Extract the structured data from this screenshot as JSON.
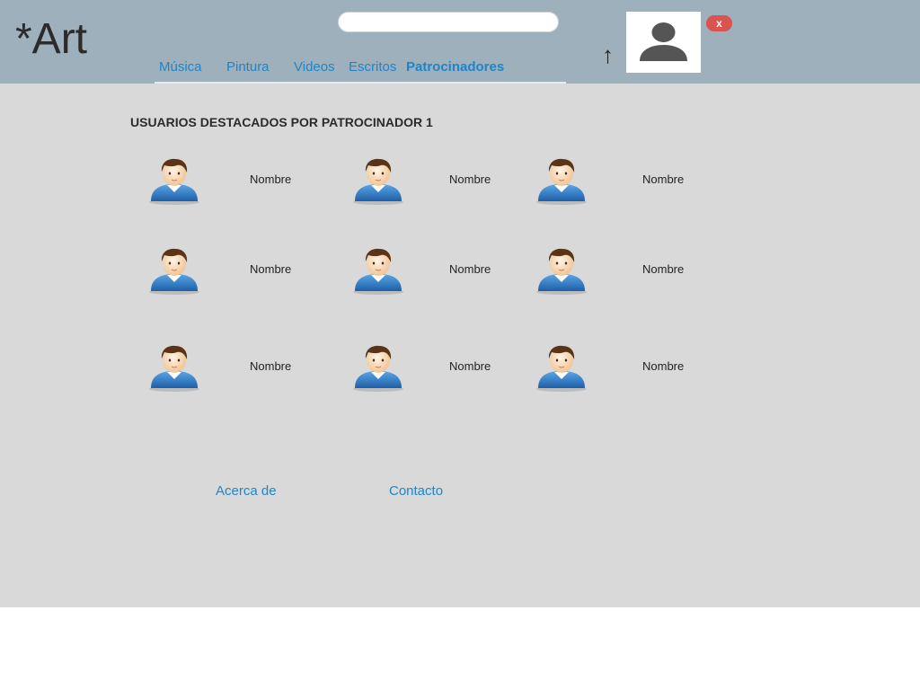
{
  "header": {
    "logo": "*Art",
    "search": {
      "value": "",
      "placeholder": ""
    },
    "nav": [
      "Música",
      "Pintura",
      "Videos",
      "Escritos",
      "Patrocinadores"
    ],
    "active_nav": "Patrocinadores",
    "upload_icon": "arrow-up-icon",
    "avatar_icon": "user-silhouette-icon",
    "close_label": "x"
  },
  "section": {
    "title": "USUARIOS DESTACADOS POR PATROCINADOR 1",
    "users": [
      {
        "name": "Nombre"
      },
      {
        "name": "Nombre"
      },
      {
        "name": "Nombre"
      },
      {
        "name": "Nombre"
      },
      {
        "name": "Nombre"
      },
      {
        "name": "Nombre"
      },
      {
        "name": "Nombre"
      },
      {
        "name": "Nombre"
      },
      {
        "name": "Nombre"
      }
    ]
  },
  "footer": {
    "about": "Acerca de",
    "contact": "Contacto"
  },
  "colors": {
    "header_bg": "#9eb0bb",
    "main_bg": "#d9d9d9",
    "link": "#1f85c8",
    "badge": "#d9534f"
  }
}
